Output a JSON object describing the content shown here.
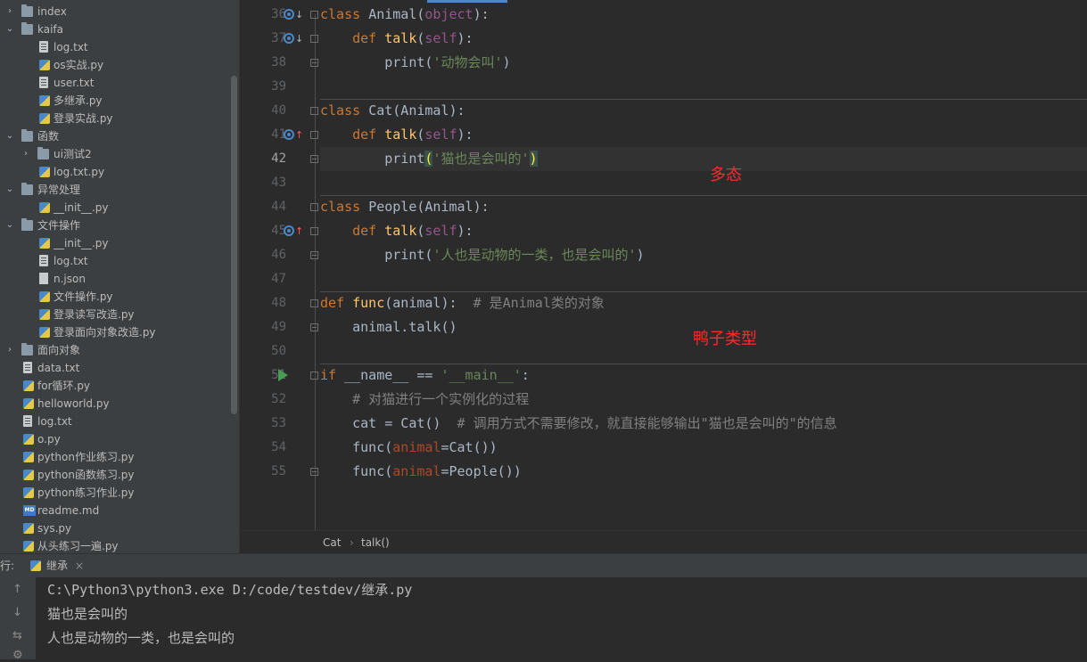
{
  "tree": {
    "items": [
      {
        "label": "index",
        "type": "folder",
        "depth": 0,
        "expanded": false
      },
      {
        "label": "kaifa",
        "type": "folder",
        "depth": 0,
        "expanded": true
      },
      {
        "label": "log.txt",
        "type": "txt",
        "depth": 1
      },
      {
        "label": "os实战.py",
        "type": "py",
        "depth": 1
      },
      {
        "label": "user.txt",
        "type": "txt",
        "depth": 1
      },
      {
        "label": "多继承.py",
        "type": "py",
        "depth": 1
      },
      {
        "label": "登录实战.py",
        "type": "py",
        "depth": 1
      },
      {
        "label": "函数",
        "type": "folder",
        "depth": 0,
        "expanded": true
      },
      {
        "label": "ui测试2",
        "type": "folder",
        "depth": 1,
        "expanded": false
      },
      {
        "label": "log.txt.py",
        "type": "py",
        "depth": 1
      },
      {
        "label": "异常处理",
        "type": "folder",
        "depth": 0,
        "expanded": true
      },
      {
        "label": "__init__.py",
        "type": "py",
        "depth": 1
      },
      {
        "label": "文件操作",
        "type": "folder",
        "depth": 0,
        "expanded": true
      },
      {
        "label": "__init__.py",
        "type": "py",
        "depth": 1
      },
      {
        "label": "log.txt",
        "type": "txt",
        "depth": 1
      },
      {
        "label": "n.json",
        "type": "json",
        "depth": 1
      },
      {
        "label": "文件操作.py",
        "type": "py",
        "depth": 1
      },
      {
        "label": "登录读写改造.py",
        "type": "py",
        "depth": 1
      },
      {
        "label": "登录面向对象改造.py",
        "type": "py",
        "depth": 1
      },
      {
        "label": "面向对象",
        "type": "folder",
        "depth": 0,
        "expanded": false
      },
      {
        "label": "data.txt",
        "type": "txt",
        "depth": 0
      },
      {
        "label": "for循环.py",
        "type": "py",
        "depth": 0
      },
      {
        "label": "helloworld.py",
        "type": "py",
        "depth": 0
      },
      {
        "label": "log.txt",
        "type": "txt",
        "depth": 0
      },
      {
        "label": "o.py",
        "type": "py",
        "depth": 0
      },
      {
        "label": "python作业练习.py",
        "type": "py",
        "depth": 0
      },
      {
        "label": "python函数练习.py",
        "type": "py",
        "depth": 0
      },
      {
        "label": "python练习作业.py",
        "type": "py",
        "depth": 0
      },
      {
        "label": "readme.md",
        "type": "md",
        "depth": 0
      },
      {
        "label": "sys.py",
        "type": "py",
        "depth": 0
      },
      {
        "label": "从头练习一遍.py",
        "type": "py",
        "depth": 0
      }
    ],
    "md_badge": "MD"
  },
  "editor": {
    "current_line": 42,
    "lines": [
      {
        "num": "36",
        "tokens": [
          {
            "t": "class ",
            "c": "kw"
          },
          {
            "t": "Animal(",
            "c": ""
          },
          {
            "t": "object",
            "c": "self"
          },
          {
            "t": "):",
            "c": ""
          }
        ]
      },
      {
        "num": "37",
        "tokens": [
          {
            "t": "    def ",
            "c": "kw"
          },
          {
            "t": "talk",
            "c": "fn"
          },
          {
            "t": "(",
            "c": ""
          },
          {
            "t": "self",
            "c": "self"
          },
          {
            "t": "):",
            "c": ""
          }
        ]
      },
      {
        "num": "38",
        "tokens": [
          {
            "t": "        print(",
            "c": ""
          },
          {
            "t": "'动物会叫'",
            "c": "str"
          },
          {
            "t": ")",
            "c": ""
          }
        ]
      },
      {
        "num": "39",
        "tokens": []
      },
      {
        "num": "40",
        "tokens": [
          {
            "t": "class ",
            "c": "kw"
          },
          {
            "t": "Cat(Animal):",
            "c": ""
          }
        ]
      },
      {
        "num": "41",
        "tokens": [
          {
            "t": "    def ",
            "c": "kw"
          },
          {
            "t": "talk",
            "c": "fn"
          },
          {
            "t": "(",
            "c": ""
          },
          {
            "t": "self",
            "c": "self"
          },
          {
            "t": "):",
            "c": ""
          }
        ]
      },
      {
        "num": "42",
        "tokens": [
          {
            "t": "        print",
            "c": ""
          },
          {
            "t": "(",
            "c": "brk"
          },
          {
            "t": "'猫也是会叫的'",
            "c": "str"
          },
          {
            "t": ")",
            "c": "brk"
          }
        ]
      },
      {
        "num": "43",
        "tokens": []
      },
      {
        "num": "44",
        "tokens": [
          {
            "t": "class ",
            "c": "kw"
          },
          {
            "t": "People(Animal):",
            "c": ""
          }
        ]
      },
      {
        "num": "45",
        "tokens": [
          {
            "t": "    def ",
            "c": "kw"
          },
          {
            "t": "talk",
            "c": "fn"
          },
          {
            "t": "(",
            "c": ""
          },
          {
            "t": "self",
            "c": "self"
          },
          {
            "t": "):",
            "c": ""
          }
        ]
      },
      {
        "num": "46",
        "tokens": [
          {
            "t": "        print(",
            "c": ""
          },
          {
            "t": "'人也是动物的一类，也是会叫的'",
            "c": "str"
          },
          {
            "t": ")",
            "c": ""
          }
        ]
      },
      {
        "num": "47",
        "tokens": []
      },
      {
        "num": "48",
        "tokens": [
          {
            "t": "def ",
            "c": "kw"
          },
          {
            "t": "func",
            "c": "fn"
          },
          {
            "t": "(animal):  ",
            "c": ""
          },
          {
            "t": "# 是Animal类的对象",
            "c": "cm"
          }
        ]
      },
      {
        "num": "49",
        "tokens": [
          {
            "t": "    animal.talk()",
            "c": ""
          }
        ]
      },
      {
        "num": "50",
        "tokens": []
      },
      {
        "num": "51",
        "tokens": [
          {
            "t": "if ",
            "c": "kw"
          },
          {
            "t": "__name__ == ",
            "c": ""
          },
          {
            "t": "'__main__'",
            "c": "str"
          },
          {
            "t": ":",
            "c": ""
          }
        ]
      },
      {
        "num": "52",
        "tokens": [
          {
            "t": "    ",
            "c": ""
          },
          {
            "t": "# 对猫进行一个实例化的过程",
            "c": "cm"
          }
        ]
      },
      {
        "num": "53",
        "tokens": [
          {
            "t": "    cat = Cat()  ",
            "c": ""
          },
          {
            "t": "# 调用方式不需要修改，就直接能够输出\"猫也是会叫的\"的信息",
            "c": "cm"
          }
        ]
      },
      {
        "num": "54",
        "tokens": [
          {
            "t": "    func(",
            "c": ""
          },
          {
            "t": "animal",
            "c": "param"
          },
          {
            "t": "=Cat())",
            "c": ""
          }
        ]
      },
      {
        "num": "55",
        "tokens": [
          {
            "t": "    func(",
            "c": ""
          },
          {
            "t": "animal",
            "c": "param"
          },
          {
            "t": "=People())",
            "c": ""
          }
        ]
      }
    ],
    "annotations": {
      "polymorphism": "多态",
      "duck_typing": "鸭子类型"
    },
    "colors": {
      "keyword": "#cc7832",
      "function": "#ffc66d",
      "string": "#6a8759",
      "comment": "#808080",
      "annotation": "#ff2b2b"
    }
  },
  "breadcrumb": {
    "items": [
      "Cat",
      "talk()"
    ],
    "separator": "›"
  },
  "run": {
    "label": "行:",
    "tab": "继承",
    "close": "×",
    "output": [
      "C:\\Python3\\python3.exe D:/code/testdev/继承.py",
      "猫也是会叫的",
      "人也是动物的一类，也是会叫的"
    ],
    "side_icons": [
      "arrow-up-icon",
      "arrow-down-icon",
      "soft-wrap-icon",
      "settings-icon"
    ]
  }
}
